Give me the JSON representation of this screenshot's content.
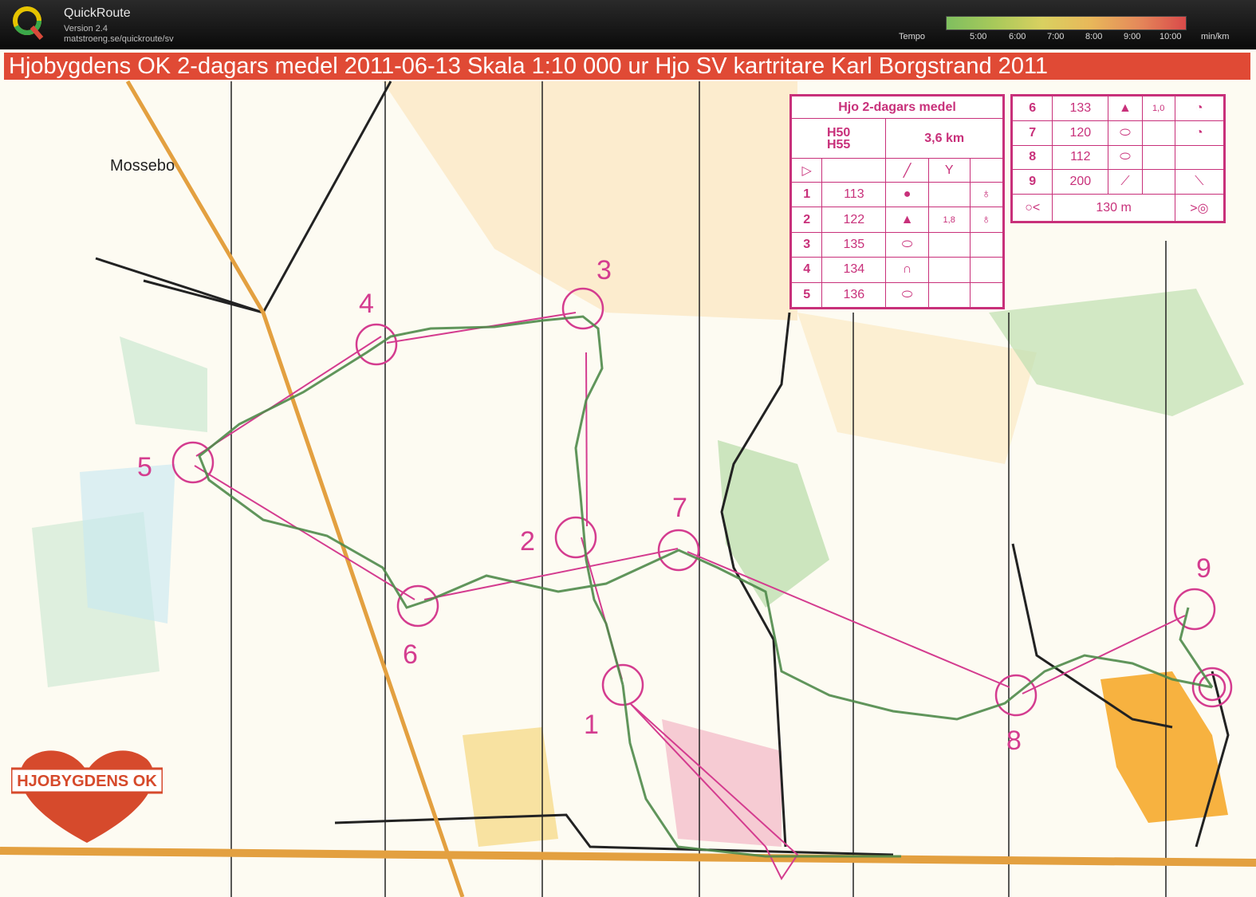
{
  "app": {
    "title": "QuickRoute",
    "version": "Version 2.4",
    "url": "matstroeng.se/quickroute/sv"
  },
  "tempo": {
    "label": "Tempo",
    "ticks": [
      "5:00",
      "6:00",
      "7:00",
      "8:00",
      "9:00",
      "10:00"
    ],
    "unit": "min/km",
    "colors": [
      "#7fbf5f",
      "#d9d060",
      "#e58a5a",
      "#d94a4a"
    ]
  },
  "map": {
    "header": "Hjobygdens OK 2-dagars medel 2011-06-13 Skala 1:10 000 ur Hjo SV  kartritare Karl Borgstrand 2011",
    "place_name": "Mossebo",
    "club_logo_text": "HJOBYGDENS OK",
    "colors": {
      "course": "#d43c8f",
      "route": "#4f8a4a",
      "header": "#e04a35"
    }
  },
  "description_sheet": {
    "title": "Hjo 2-dagars medel",
    "classes": "H50\nH55",
    "length": "3,6 km",
    "controls_left": [
      {
        "n": "1",
        "code": "113",
        "symbol": "●",
        "dist": "",
        "extra": "♁"
      },
      {
        "n": "2",
        "code": "122",
        "symbol": "▲",
        "dist": "1,8",
        "extra": "♁"
      },
      {
        "n": "3",
        "code": "135",
        "symbol": "⬭",
        "dist": "",
        "extra": ""
      },
      {
        "n": "4",
        "code": "134",
        "symbol": "∩",
        "dist": "",
        "extra": ""
      },
      {
        "n": "5",
        "code": "136",
        "symbol": "⬭",
        "dist": "",
        "extra": ""
      }
    ],
    "controls_right": [
      {
        "n": "6",
        "code": "133",
        "symbol": "▲",
        "dist": "1,0",
        "extra": "◔"
      },
      {
        "n": "7",
        "code": "120",
        "symbol": "⬭",
        "dist": "",
        "extra": "◔"
      },
      {
        "n": "8",
        "code": "112",
        "symbol": "⬭",
        "dist": "",
        "extra": ""
      },
      {
        "n": "9",
        "code": "200",
        "symbol": "⟋",
        "dist": "",
        "extra": "⟍"
      }
    ],
    "finish_distance": "130 m"
  },
  "control_labels": [
    "1",
    "2",
    "3",
    "4",
    "5",
    "6",
    "7",
    "8",
    "9"
  ]
}
